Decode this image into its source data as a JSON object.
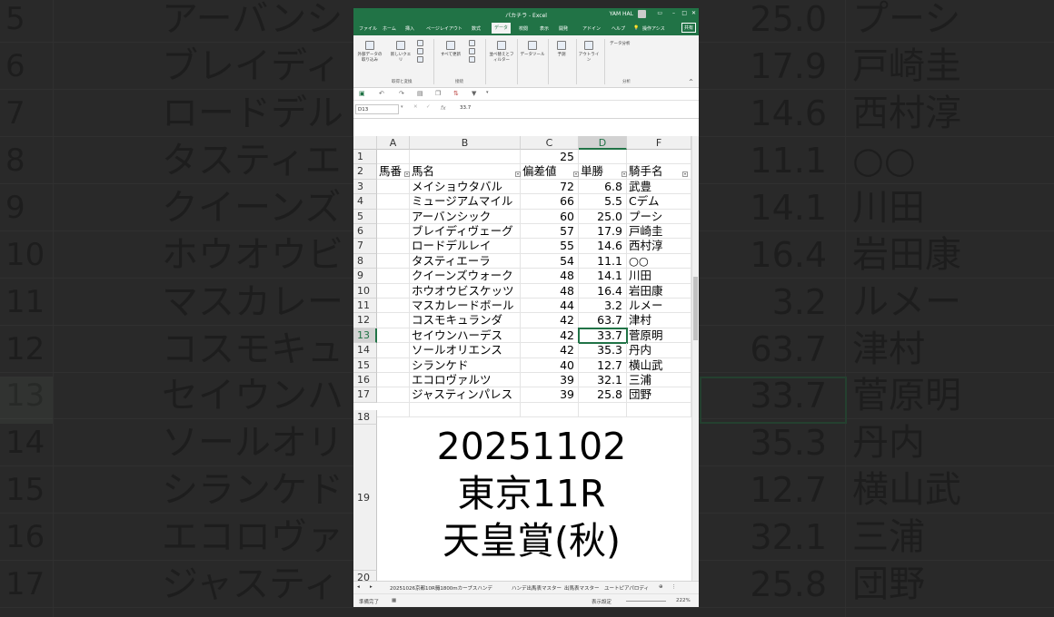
{
  "window": {
    "title": "パカチラ - Excel",
    "user": "YAM HAL",
    "share_label": "共有"
  },
  "ribbon": {
    "tabs": [
      "ファイル",
      "ホーム",
      "挿入",
      "ページレイアウト",
      "数式",
      "データ",
      "校閲",
      "表示",
      "開発",
      "アドイン",
      "ヘルプ"
    ],
    "active_tab": "データ",
    "tell_me": "操作アシス",
    "buttons": [
      "外部データの取り込み",
      "新しいクエリ",
      "すべて更新",
      "並べ替えとフィルター",
      "データツール",
      "予測",
      "アウトライン",
      "データ分析"
    ],
    "groups": [
      "取得と変換",
      "接続",
      "分析"
    ]
  },
  "formula_bar": {
    "name_box": "D13",
    "fx": "fx",
    "value": "33.7"
  },
  "columns": [
    "A",
    "B",
    "C",
    "D",
    "F"
  ],
  "row1": {
    "row": "1",
    "c_value": "25"
  },
  "headers": {
    "row": "2",
    "a": "馬番",
    "b": "馬名",
    "c": "偏差値",
    "d": "単勝",
    "f": "騎手名"
  },
  "rows": [
    {
      "row": "3",
      "name": "メイショウタバル",
      "dev": "72",
      "odds": "6.8",
      "jockey": "武豊"
    },
    {
      "row": "4",
      "name": "ミュージアムマイル",
      "dev": "66",
      "odds": "5.5",
      "jockey": "Cデム"
    },
    {
      "row": "5",
      "name": "アーバンシック",
      "dev": "60",
      "odds": "25.0",
      "jockey": "プーシ"
    },
    {
      "row": "6",
      "name": "ブレイディヴェーグ",
      "dev": "57",
      "odds": "17.9",
      "jockey": "戸崎圭"
    },
    {
      "row": "7",
      "name": "ロードデルレイ",
      "dev": "55",
      "odds": "14.6",
      "jockey": "西村淳"
    },
    {
      "row": "8",
      "name": "タスティエーラ",
      "dev": "54",
      "odds": "11.1",
      "jockey": "○○"
    },
    {
      "row": "9",
      "name": "クイーンズウォーク",
      "dev": "48",
      "odds": "14.1",
      "jockey": "川田"
    },
    {
      "row": "10",
      "name": "ホウオウビスケッツ",
      "dev": "48",
      "odds": "16.4",
      "jockey": "岩田康"
    },
    {
      "row": "11",
      "name": "マスカレードボール",
      "dev": "44",
      "odds": "3.2",
      "jockey": "ルメー"
    },
    {
      "row": "12",
      "name": "コスモキュランダ",
      "dev": "42",
      "odds": "63.7",
      "jockey": "津村"
    },
    {
      "row": "13",
      "name": "セイウンハーデス",
      "dev": "42",
      "odds": "33.7",
      "jockey": "菅原明"
    },
    {
      "row": "14",
      "name": "ソールオリエンス",
      "dev": "42",
      "odds": "35.3",
      "jockey": "丹内"
    },
    {
      "row": "15",
      "name": "シランケド",
      "dev": "40",
      "odds": "12.7",
      "jockey": "横山武"
    },
    {
      "row": "16",
      "name": "エコロヴァルツ",
      "dev": "39",
      "odds": "32.1",
      "jockey": "三浦"
    },
    {
      "row": "17",
      "name": "ジャスティンパレス",
      "dev": "39",
      "odds": "25.8",
      "jockey": "団野"
    }
  ],
  "row18": "18",
  "row19": "19",
  "row20": "20",
  "overlay": {
    "line1": "20251102",
    "line2": "東京11R",
    "line3": "天皇賞(秋)"
  },
  "sheet_tabs": [
    "20251026京都10R艥1800mカープスハンデ",
    "ハンデ出馬表マスター",
    "出馬表マスター",
    "ユートピアパロディ"
  ],
  "status": {
    "ready": "準備完了",
    "display_settings": "表示設定",
    "zoom": "222%"
  },
  "background": {
    "row_numbers": [
      "5",
      "6",
      "7",
      "8",
      "9",
      "10",
      "11",
      "12",
      "13",
      "14",
      "15",
      "16",
      "17"
    ],
    "names": [
      "アーバンシ",
      "ブレイディヴ",
      "ロードデルレ",
      "タスティエー",
      "クイーンズウ",
      "ホウオウビス",
      "マスカレード",
      "コスモキュラ",
      "セイウンハー",
      "ソールオリエ",
      "シランケド",
      "エコロヴァル",
      "ジャスティン"
    ],
    "odds": [
      "25.0",
      "17.9",
      "14.6",
      "11.1",
      "14.1",
      "16.4",
      "3.2",
      "63.7",
      "33.7",
      "35.3",
      "12.7",
      "32.1",
      "25.8"
    ],
    "jockeys": [
      "プーシ",
      "戸崎圭",
      "西村淳",
      "○○",
      "川田",
      "岩田康",
      "ルメー",
      "津村",
      "菅原明",
      "丹内",
      "横山武",
      "三浦",
      "団野"
    ]
  },
  "colors": {
    "excel_green": "#217346",
    "selection": "#217346"
  }
}
